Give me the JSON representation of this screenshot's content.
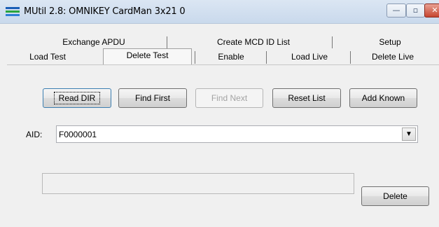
{
  "window": {
    "title": "MUtil 2.8: OMNIKEY CardMan 3x21 0",
    "controls": {
      "minimize": "—",
      "maximize": "▫",
      "close": "✕"
    }
  },
  "tabs": {
    "row1": [
      "Exchange APDU",
      "Create MCD ID List",
      "Setup"
    ],
    "row2": [
      "Load Test",
      "Delete Test",
      "Enable",
      "Load Live",
      "Delete Live"
    ],
    "selected": "Delete Test"
  },
  "buttons": {
    "read_dir": "Read DIR",
    "find_first": "Find First",
    "find_next": "Find Next",
    "reset_list": "Reset List",
    "add_known": "Add Known",
    "delete": "Delete"
  },
  "aid": {
    "label": "AID:",
    "value": "F0000001",
    "arrow": "▼"
  },
  "status": {
    "text": ""
  },
  "colors": {
    "icon_stripes": [
      "#1b5fb6",
      "#2aa53d",
      "#2f7fd6"
    ],
    "close_button": "#c6452f",
    "focus_border": "#3c7fb1"
  }
}
